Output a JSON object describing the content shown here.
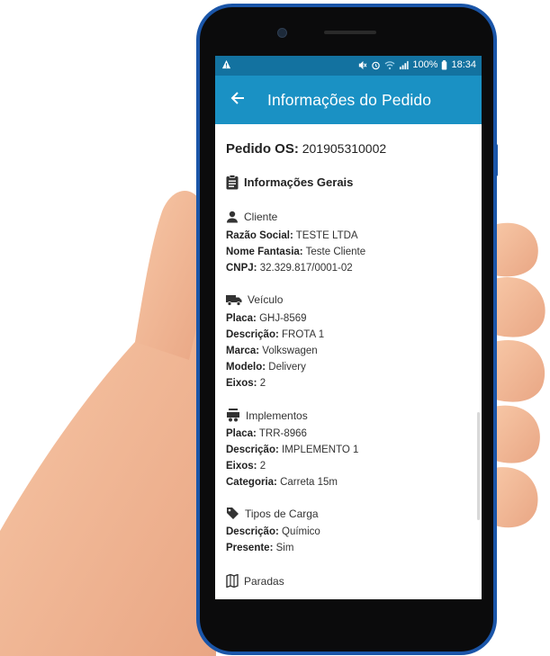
{
  "status_bar": {
    "alert_icon": "warning-triangle",
    "battery_percent": "100%",
    "time": "18:34"
  },
  "app_bar": {
    "back_icon": "arrow-left",
    "title": "Informações do Pedido"
  },
  "order": {
    "label": "Pedido OS:",
    "number": "201905310002"
  },
  "general_info": {
    "icon": "clipboard-icon",
    "title": "Informações Gerais"
  },
  "sections": {
    "cliente": {
      "icon": "person-icon",
      "title": "Cliente",
      "fields": [
        {
          "label": "Razão Social:",
          "value": "TESTE LTDA"
        },
        {
          "label": "Nome Fantasia:",
          "value": "Teste Cliente"
        },
        {
          "label": "CNPJ:",
          "value": "32.329.817/0001-02"
        }
      ]
    },
    "veiculo": {
      "icon": "truck-icon",
      "title": "Veículo",
      "fields": [
        {
          "label": "Placa:",
          "value": "GHJ-8569"
        },
        {
          "label": "Descrição:",
          "value": "FROTA 1"
        },
        {
          "label": "Marca:",
          "value": "Volkswagen"
        },
        {
          "label": "Modelo:",
          "value": "Delivery"
        },
        {
          "label": "Eixos:",
          "value": "2"
        }
      ]
    },
    "implementos": {
      "icon": "trailer-icon",
      "title": "Implementos",
      "fields": [
        {
          "label": "Placa:",
          "value": "TRR-8966"
        },
        {
          "label": "Descrição:",
          "value": "IMPLEMENTO 1"
        },
        {
          "label": "Eixos:",
          "value": "2"
        },
        {
          "label": "Categoria:",
          "value": "Carreta 15m"
        }
      ]
    },
    "carga": {
      "icon": "tag-icon",
      "title": "Tipos de Carga",
      "fields": [
        {
          "label": "Descrição:",
          "value": "Químico"
        },
        {
          "label": "Presente:",
          "value": "Sim"
        }
      ]
    },
    "paradas": {
      "icon": "map-icon",
      "title": "Paradas"
    }
  },
  "colors": {
    "app_bar": "#1a91c4",
    "status_bar": "#1372a0",
    "phone_frame": "#1a55a8"
  }
}
